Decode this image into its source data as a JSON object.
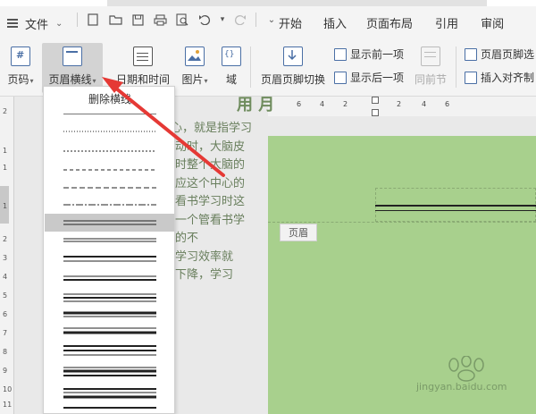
{
  "menubar": {
    "file_label": "文件",
    "menus": [
      "开始",
      "插入",
      "页面布局",
      "引用",
      "审阅"
    ]
  },
  "ribbon": {
    "page_number": "页码",
    "header_line": "页眉横线",
    "datetime": "日期和时间",
    "picture": "图片",
    "field": "域",
    "switch_header_footer": "页眉页脚切换",
    "show_prev": "显示前一项",
    "show_next": "显示后一项",
    "same_as_prev": "同前节",
    "header_footer_options": "页眉页脚选",
    "insert_align_tab": "插入对齐制"
  },
  "dropdown": {
    "title": "删除横线",
    "selected_index": 6
  },
  "ruler": {
    "top_numbers": [
      "6",
      "4",
      "2",
      "2",
      "4",
      "6"
    ],
    "left_marks": [
      "2",
      "1",
      "1",
      "1",
      "2",
      "3",
      "4",
      "5",
      "6",
      "7",
      "8",
      "9",
      "10",
      "11",
      "12"
    ]
  },
  "document": {
    "header_tag": "页眉",
    "title": "用 月",
    "lines": [
      "所谓专心，就是指学习",
      "神从事某种活动时，大脑皮",
      "抑制状态，此时整个大脑的",
      "能量都用来供应这个中心的",
      "好。反之，在看书学习时这",
      "个兴奋中心，一个管看书学",
      "  它们相互干扰的不",
      "都消耗能量，学习效率就",
      "工作效率就会下降，学习"
    ]
  },
  "watermark": {
    "text": "jingyan.baidu.com"
  },
  "colors": {
    "page_bg": "#a8d08d",
    "arrow": "#e53935",
    "accent": "#4a6fa5"
  }
}
